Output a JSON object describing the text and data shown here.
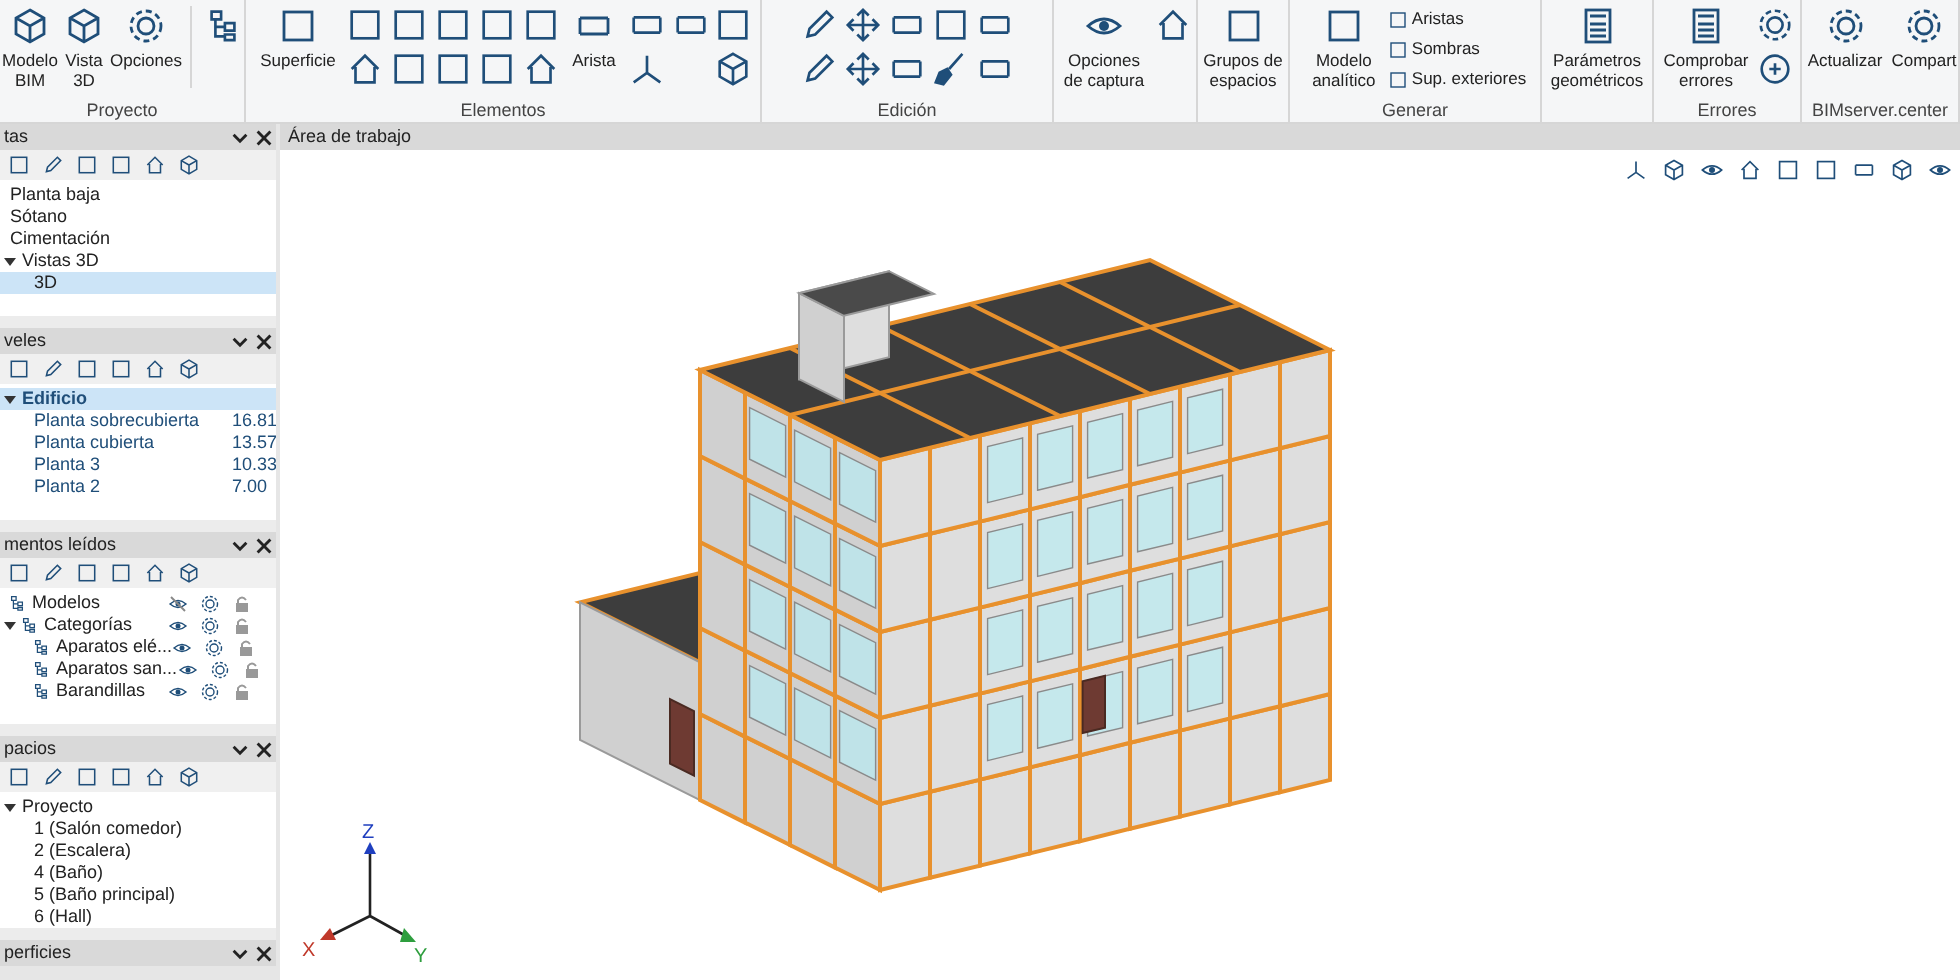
{
  "ribbon": {
    "groups": [
      {
        "label": "Proyecto",
        "buttons": [
          {
            "label": "Modelo BIM"
          },
          {
            "label": "Vista 3D"
          },
          {
            "label": "Opciones"
          }
        ]
      },
      {
        "label": "Elementos",
        "buttons": [
          {
            "label": "Superficie"
          },
          {
            "label": "Arista"
          }
        ]
      },
      {
        "label": "Edición"
      },
      {
        "buttons": [
          {
            "label": "Opciones de captura"
          }
        ]
      },
      {
        "buttons": [
          {
            "label": "Grupos de espacios"
          }
        ]
      },
      {
        "label": "Generar",
        "buttons": [
          {
            "label": "Modelo analítico"
          }
        ],
        "small_buttons": [
          {
            "label": "Aristas"
          },
          {
            "label": "Sombras"
          },
          {
            "label": "Sup. exteriores"
          }
        ]
      },
      {
        "buttons": [
          {
            "label": "Parámetros geométricos"
          }
        ]
      },
      {
        "label": "Errores",
        "buttons": [
          {
            "label": "Comprobar errores"
          }
        ]
      },
      {
        "label": "BIMserver.center",
        "buttons": [
          {
            "label": "Actualizar"
          },
          {
            "label": "Compart"
          }
        ]
      }
    ]
  },
  "panels": [
    {
      "kind": "tree",
      "title": "tas",
      "items": [
        {
          "label": "Planta baja",
          "selected": false
        },
        {
          "label": "Sótano",
          "selected": false
        },
        {
          "label": "Cimentación",
          "selected": false
        },
        {
          "label": "Vistas 3D",
          "selected": false,
          "expanded": true,
          "children": [
            {
              "label": "3D",
              "selected": true
            }
          ]
        }
      ]
    },
    {
      "kind": "levels",
      "title": "veles",
      "items": [
        {
          "label": "Edificio",
          "selected": true,
          "expanded": true,
          "children": [
            {
              "label": "Planta sobrecubierta",
              "value": "16.81",
              "selected": false
            },
            {
              "label": "Planta cubierta",
              "value": "13.57",
              "selected": false
            },
            {
              "label": "Planta 3",
              "value": "10.33",
              "selected": false
            },
            {
              "label": "Planta 2",
              "value": "7.00",
              "selected": false
            }
          ]
        }
      ]
    },
    {
      "kind": "elements",
      "title": "mentos leídos",
      "items": [
        {
          "label": "Modelos",
          "visible": false
        },
        {
          "label": "Categorías",
          "visible": true,
          "expanded": true,
          "children": [
            {
              "label": "Aparatos elé...",
              "visible": true
            },
            {
              "label": "Aparatos san...",
              "visible": true
            },
            {
              "label": "Barandillas",
              "visible": true
            }
          ]
        }
      ]
    },
    {
      "kind": "tree",
      "title": "pacios",
      "items": [
        {
          "label": "Proyecto",
          "selected": false,
          "expanded": true,
          "children": [
            {
              "label": "1 (Salón comedor)",
              "selected": false
            },
            {
              "label": "2 (Escalera)",
              "selected": false
            },
            {
              "label": "4 (Baño)",
              "selected": false
            },
            {
              "label": "5 (Baño principal)",
              "selected": false
            },
            {
              "label": "6 (Hall)",
              "selected": false
            }
          ]
        }
      ]
    },
    {
      "kind": "collapsed",
      "title": "perficies"
    }
  ],
  "workspace": {
    "title": "Área de trabajo",
    "axes": [
      "Z",
      "X",
      "Y"
    ]
  }
}
